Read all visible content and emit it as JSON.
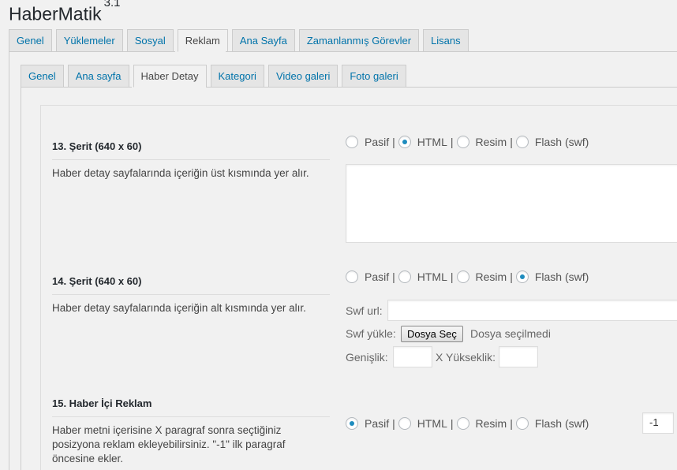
{
  "app": {
    "title": "HaberMatik",
    "version": "3.1"
  },
  "main_tabs": [
    {
      "label": "Genel",
      "active": false
    },
    {
      "label": "Yüklemeler",
      "active": false
    },
    {
      "label": "Sosyal",
      "active": false
    },
    {
      "label": "Reklam",
      "active": true
    },
    {
      "label": "Ana Sayfa",
      "active": false
    },
    {
      "label": "Zamanlanmış Görevler",
      "active": false
    },
    {
      "label": "Lisans",
      "active": false
    }
  ],
  "sub_tabs": [
    {
      "label": "Genel",
      "active": false
    },
    {
      "label": "Ana sayfa",
      "active": false
    },
    {
      "label": "Haber Detay",
      "active": true
    },
    {
      "label": "Kategori",
      "active": false
    },
    {
      "label": "Video galeri",
      "active": false
    },
    {
      "label": "Foto galeri",
      "active": false
    }
  ],
  "radio_options": [
    "Pasif",
    "HTML",
    "Resim",
    "Flash (swf)"
  ],
  "separator": "|",
  "sections": [
    {
      "title": "13. Şerit (640 x 60)",
      "description": "Haber detay sayfalarında içeriğin üst kısmında yer alır.",
      "selected": "HTML",
      "html_content": ""
    },
    {
      "title": "14. Şerit (640 x 60)",
      "description": "Haber detay sayfalarında içeriğin alt kısmında yer alır.",
      "selected": "Flash (swf)",
      "swf_url_label": "Swf url:",
      "swf_url_value": "",
      "swf_upload_label": "Swf yükle:",
      "file_button": "Dosya Seç",
      "file_status": "Dosya seçilmedi",
      "width_label": "Genişlik:",
      "width_value": "",
      "height_label": "X Yükseklik:",
      "height_value": ""
    },
    {
      "title": "15. Haber İçi Reklam",
      "description": "Haber metni içerisine X paragraf sonra seçtiğiniz posizyona reklam ekleyebilirsiniz. \"-1\" ilk paragraf öncesine ekler.",
      "selected": "Pasif",
      "paragraph_value": "-1"
    }
  ],
  "colors": {
    "accent": "#0073aa",
    "radio_dot": "#1e8cbe",
    "background": "#f1f1f1"
  }
}
